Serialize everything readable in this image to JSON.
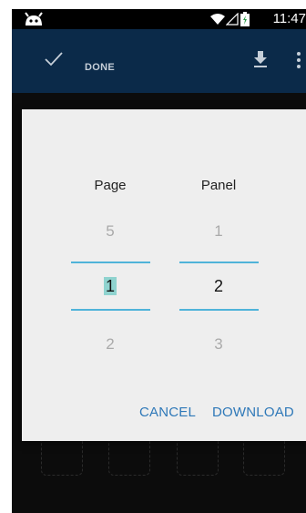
{
  "status_bar": {
    "time": "11:47"
  },
  "action_bar": {
    "done_label": "DONE"
  },
  "dialog": {
    "page": {
      "title": "Page",
      "above": "5",
      "selected": "1",
      "below": "2"
    },
    "panel": {
      "title": "Panel",
      "above": "1",
      "selected": "2",
      "below": "3"
    },
    "cancel_label": "CANCEL",
    "download_label": "DOWNLOAD"
  },
  "colors": {
    "action_bar": "#0b2a49",
    "accent": "#2e78b8",
    "picker_line": "#4fb3d9",
    "selection_highlight": "#8fd3cf"
  }
}
